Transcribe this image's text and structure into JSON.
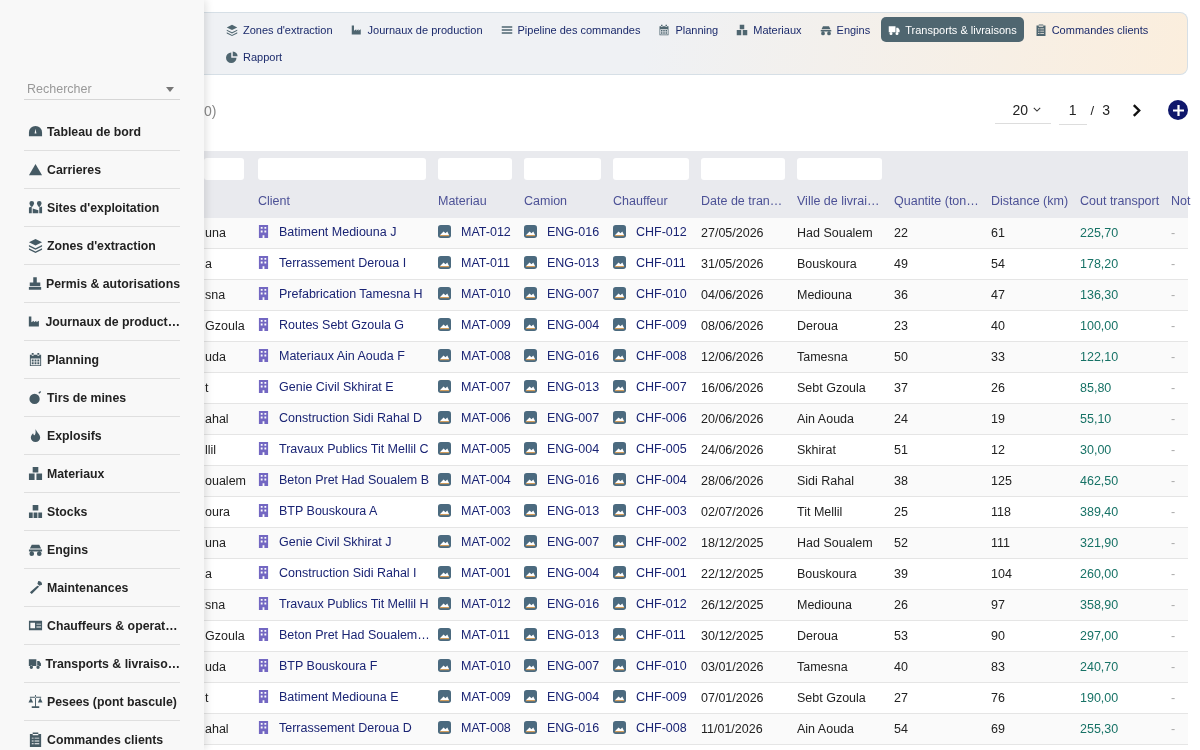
{
  "sidebar": {
    "search": {
      "placeholder": "Rechercher"
    },
    "items": [
      {
        "label": "Tableau de bord",
        "kind": "gauge"
      },
      {
        "label": "Carrieres",
        "kind": "mountain"
      },
      {
        "label": "Sites d'exploitation",
        "kind": "map"
      },
      {
        "label": "Zones d'extraction",
        "kind": "layers"
      },
      {
        "label": "Permis & autorisations",
        "kind": "stamp"
      },
      {
        "label": "Journaux de product…",
        "kind": "factory"
      },
      {
        "label": "Planning",
        "kind": "calendar"
      },
      {
        "label": "Tirs de mines",
        "kind": "bomb"
      },
      {
        "label": "Explosifs",
        "kind": "drop"
      },
      {
        "label": "Materiaux",
        "kind": "cubes"
      },
      {
        "label": "Stocks",
        "kind": "boxes"
      },
      {
        "label": "Engins",
        "kind": "tractor"
      },
      {
        "label": "Maintenances",
        "kind": "wrench"
      },
      {
        "label": "Chauffeurs & operat…",
        "kind": "card"
      },
      {
        "label": "Transports & livraiso…",
        "kind": "truck"
      },
      {
        "label": "Pesees (pont bascule)",
        "kind": "scale"
      },
      {
        "label": "Commandes clients",
        "kind": "clipboard"
      }
    ]
  },
  "tabs": [
    {
      "label": "Zones d'extraction",
      "kind": "layers",
      "selected": false
    },
    {
      "label": "Journaux de production",
      "kind": "factory",
      "selected": false
    },
    {
      "label": "Pipeline des commandes",
      "kind": "list",
      "selected": false
    },
    {
      "label": "Planning",
      "kind": "calendar",
      "selected": false
    },
    {
      "label": "Materiaux",
      "kind": "cubes",
      "selected": false
    },
    {
      "label": "Engins",
      "kind": "tractor",
      "selected": false
    },
    {
      "label": "Transports & livraisons",
      "kind": "truck",
      "selected": true
    },
    {
      "label": "Commandes clients",
      "kind": "clipboard",
      "selected": false
    },
    {
      "label": "Rapport",
      "kind": "pie",
      "selected": false
    }
  ],
  "toolbar": {
    "count_text": "0)",
    "page_size": "20",
    "page": "1",
    "separator": "/",
    "total_pages": "3"
  },
  "table": {
    "columns": [
      "",
      "Client",
      "Materiau",
      "Camion",
      "Chauffeur",
      "Date de tran…",
      "Ville de livrai…",
      "Quantite (ton…",
      "Distance (km)",
      "Cout transport",
      "Not"
    ],
    "rows": [
      {
        "column_1": "una",
        "client": "Batiment Mediouna J",
        "materiau": "MAT-012",
        "camion": "ENG-016",
        "chauffeur": "CHF-012",
        "date": "27/05/2026",
        "ville": "Had Soualem",
        "quantite": "22",
        "distance": "61",
        "cout": "225,70",
        "note": "-"
      },
      {
        "column_1": "a",
        "client": "Terrassement Deroua I",
        "materiau": "MAT-011",
        "camion": "ENG-013",
        "chauffeur": "CHF-011",
        "date": "31/05/2026",
        "ville": "Bouskoura",
        "quantite": "49",
        "distance": "54",
        "cout": "178,20",
        "note": "-"
      },
      {
        "column_1": "sna",
        "client": "Prefabrication Tamesna H",
        "materiau": "MAT-010",
        "camion": "ENG-007",
        "chauffeur": "CHF-010",
        "date": "04/06/2026",
        "ville": "Mediouna",
        "quantite": "36",
        "distance": "47",
        "cout": "136,30",
        "note": "-"
      },
      {
        "column_1": "Gzoula",
        "client": "Routes Sebt Gzoula G",
        "materiau": "MAT-009",
        "camion": "ENG-004",
        "chauffeur": "CHF-009",
        "date": "08/06/2026",
        "ville": "Deroua",
        "quantite": "23",
        "distance": "40",
        "cout": "100,00",
        "note": "-"
      },
      {
        "column_1": "uda",
        "client": "Materiaux Ain Aouda F",
        "materiau": "MAT-008",
        "camion": "ENG-016",
        "chauffeur": "CHF-008",
        "date": "12/06/2026",
        "ville": "Tamesna",
        "quantite": "50",
        "distance": "33",
        "cout": "122,10",
        "note": "-"
      },
      {
        "column_1": "t",
        "client": "Genie Civil Skhirat E",
        "materiau": "MAT-007",
        "camion": "ENG-013",
        "chauffeur": "CHF-007",
        "date": "16/06/2026",
        "ville": "Sebt Gzoula",
        "quantite": "37",
        "distance": "26",
        "cout": "85,80",
        "note": "-"
      },
      {
        "column_1": "ahal",
        "client": "Construction Sidi Rahal D",
        "materiau": "MAT-006",
        "camion": "ENG-007",
        "chauffeur": "CHF-006",
        "date": "20/06/2026",
        "ville": "Ain Aouda",
        "quantite": "24",
        "distance": "19",
        "cout": "55,10",
        "note": "-"
      },
      {
        "column_1": "llil",
        "client": "Travaux Publics Tit Mellil C",
        "materiau": "MAT-005",
        "camion": "ENG-004",
        "chauffeur": "CHF-005",
        "date": "24/06/2026",
        "ville": "Skhirat",
        "quantite": "51",
        "distance": "12",
        "cout": "30,00",
        "note": "-"
      },
      {
        "column_1": "oualem",
        "client": "Beton Pret Had Soualem B",
        "materiau": "MAT-004",
        "camion": "ENG-016",
        "chauffeur": "CHF-004",
        "date": "28/06/2026",
        "ville": "Sidi Rahal",
        "quantite": "38",
        "distance": "125",
        "cout": "462,50",
        "note": "-"
      },
      {
        "column_1": "oura",
        "client": "BTP Bouskoura A",
        "materiau": "MAT-003",
        "camion": "ENG-013",
        "chauffeur": "CHF-003",
        "date": "02/07/2026",
        "ville": "Tit Mellil",
        "quantite": "25",
        "distance": "118",
        "cout": "389,40",
        "note": "-"
      },
      {
        "column_1": "una",
        "client": "Genie Civil Skhirat J",
        "materiau": "MAT-002",
        "camion": "ENG-007",
        "chauffeur": "CHF-002",
        "date": "18/12/2025",
        "ville": "Had Soualem",
        "quantite": "52",
        "distance": "111",
        "cout": "321,90",
        "note": "-"
      },
      {
        "column_1": "a",
        "client": "Construction Sidi Rahal I",
        "materiau": "MAT-001",
        "camion": "ENG-004",
        "chauffeur": "CHF-001",
        "date": "22/12/2025",
        "ville": "Bouskoura",
        "quantite": "39",
        "distance": "104",
        "cout": "260,00",
        "note": "-"
      },
      {
        "column_1": "sna",
        "client": "Travaux Publics Tit Mellil H",
        "materiau": "MAT-012",
        "camion": "ENG-016",
        "chauffeur": "CHF-012",
        "date": "26/12/2025",
        "ville": "Mediouna",
        "quantite": "26",
        "distance": "97",
        "cout": "358,90",
        "note": "-"
      },
      {
        "column_1": "Gzoula",
        "client": "Beton Pret Had Soualem…",
        "materiau": "MAT-011",
        "camion": "ENG-013",
        "chauffeur": "CHF-011",
        "date": "30/12/2025",
        "ville": "Deroua",
        "quantite": "53",
        "distance": "90",
        "cout": "297,00",
        "note": "-"
      },
      {
        "column_1": "uda",
        "client": "BTP Bouskoura F",
        "materiau": "MAT-010",
        "camion": "ENG-007",
        "chauffeur": "CHF-010",
        "date": "03/01/2026",
        "ville": "Tamesna",
        "quantite": "40",
        "distance": "83",
        "cout": "240,70",
        "note": "-"
      },
      {
        "column_1": "t",
        "client": "Batiment Mediouna E",
        "materiau": "MAT-009",
        "camion": "ENG-004",
        "chauffeur": "CHF-009",
        "date": "07/01/2026",
        "ville": "Sebt Gzoula",
        "quantite": "27",
        "distance": "76",
        "cout": "190,00",
        "note": "-"
      },
      {
        "column_1": "ahal",
        "client": "Terrassement Deroua D",
        "materiau": "MAT-008",
        "camion": "ENG-016",
        "chauffeur": "CHF-008",
        "date": "11/01/2026",
        "ville": "Ain Aouda",
        "quantite": "54",
        "distance": "69",
        "cout": "255,30",
        "note": "-"
      }
    ]
  }
}
